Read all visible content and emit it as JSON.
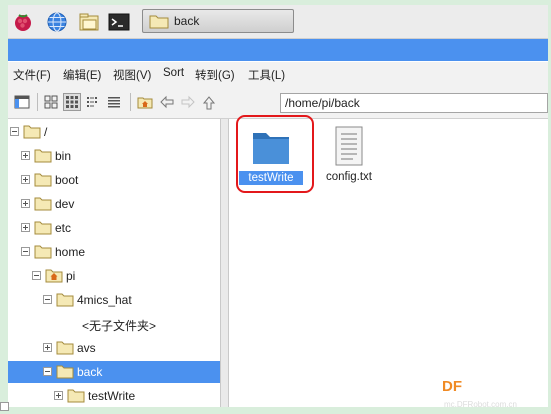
{
  "taskbar": {
    "icons": [
      "raspberry-icon",
      "globe-icon",
      "file-manager-icon",
      "terminal-icon"
    ],
    "active_task": "back"
  },
  "menubar": {
    "items": [
      "文件(F)",
      "编辑(E)",
      "视图(V)",
      "Sort",
      "转到(G)",
      "工具(L)"
    ]
  },
  "toolbar": {
    "path": "/home/pi/back"
  },
  "tree": {
    "items": [
      {
        "label": "/",
        "indent": 0,
        "expanded": true,
        "folder": "normal"
      },
      {
        "label": "bin",
        "indent": 1,
        "expanded": false,
        "folder": "normal"
      },
      {
        "label": "boot",
        "indent": 1,
        "expanded": false,
        "folder": "normal"
      },
      {
        "label": "dev",
        "indent": 1,
        "expanded": false,
        "folder": "normal"
      },
      {
        "label": "etc",
        "indent": 1,
        "expanded": false,
        "folder": "normal"
      },
      {
        "label": "home",
        "indent": 1,
        "expanded": true,
        "folder": "normal"
      },
      {
        "label": "pi",
        "indent": 2,
        "expanded": true,
        "folder": "home"
      },
      {
        "label": "4mics_hat",
        "indent": 3,
        "expanded": true,
        "folder": "normal"
      },
      {
        "label": "<无子文件夹>",
        "indent": 4,
        "expanded": null,
        "folder": "none"
      },
      {
        "label": "avs",
        "indent": 3,
        "expanded": false,
        "folder": "normal"
      },
      {
        "label": "back",
        "indent": 3,
        "expanded": true,
        "folder": "normal",
        "selected": true
      },
      {
        "label": "testWrite",
        "indent": 4,
        "expanded": false,
        "folder": "normal"
      }
    ]
  },
  "files": {
    "items": [
      {
        "name": "testWrite",
        "type": "folder",
        "selected": true
      },
      {
        "name": "config.txt",
        "type": "text-file",
        "selected": false
      }
    ]
  },
  "watermark": {
    "text": "DF",
    "subtext": "mc.DFRobot.com.cn"
  },
  "colors": {
    "selection": "#4b91ef",
    "highlight_box": "#e3181b",
    "background": "#d9eedc"
  }
}
